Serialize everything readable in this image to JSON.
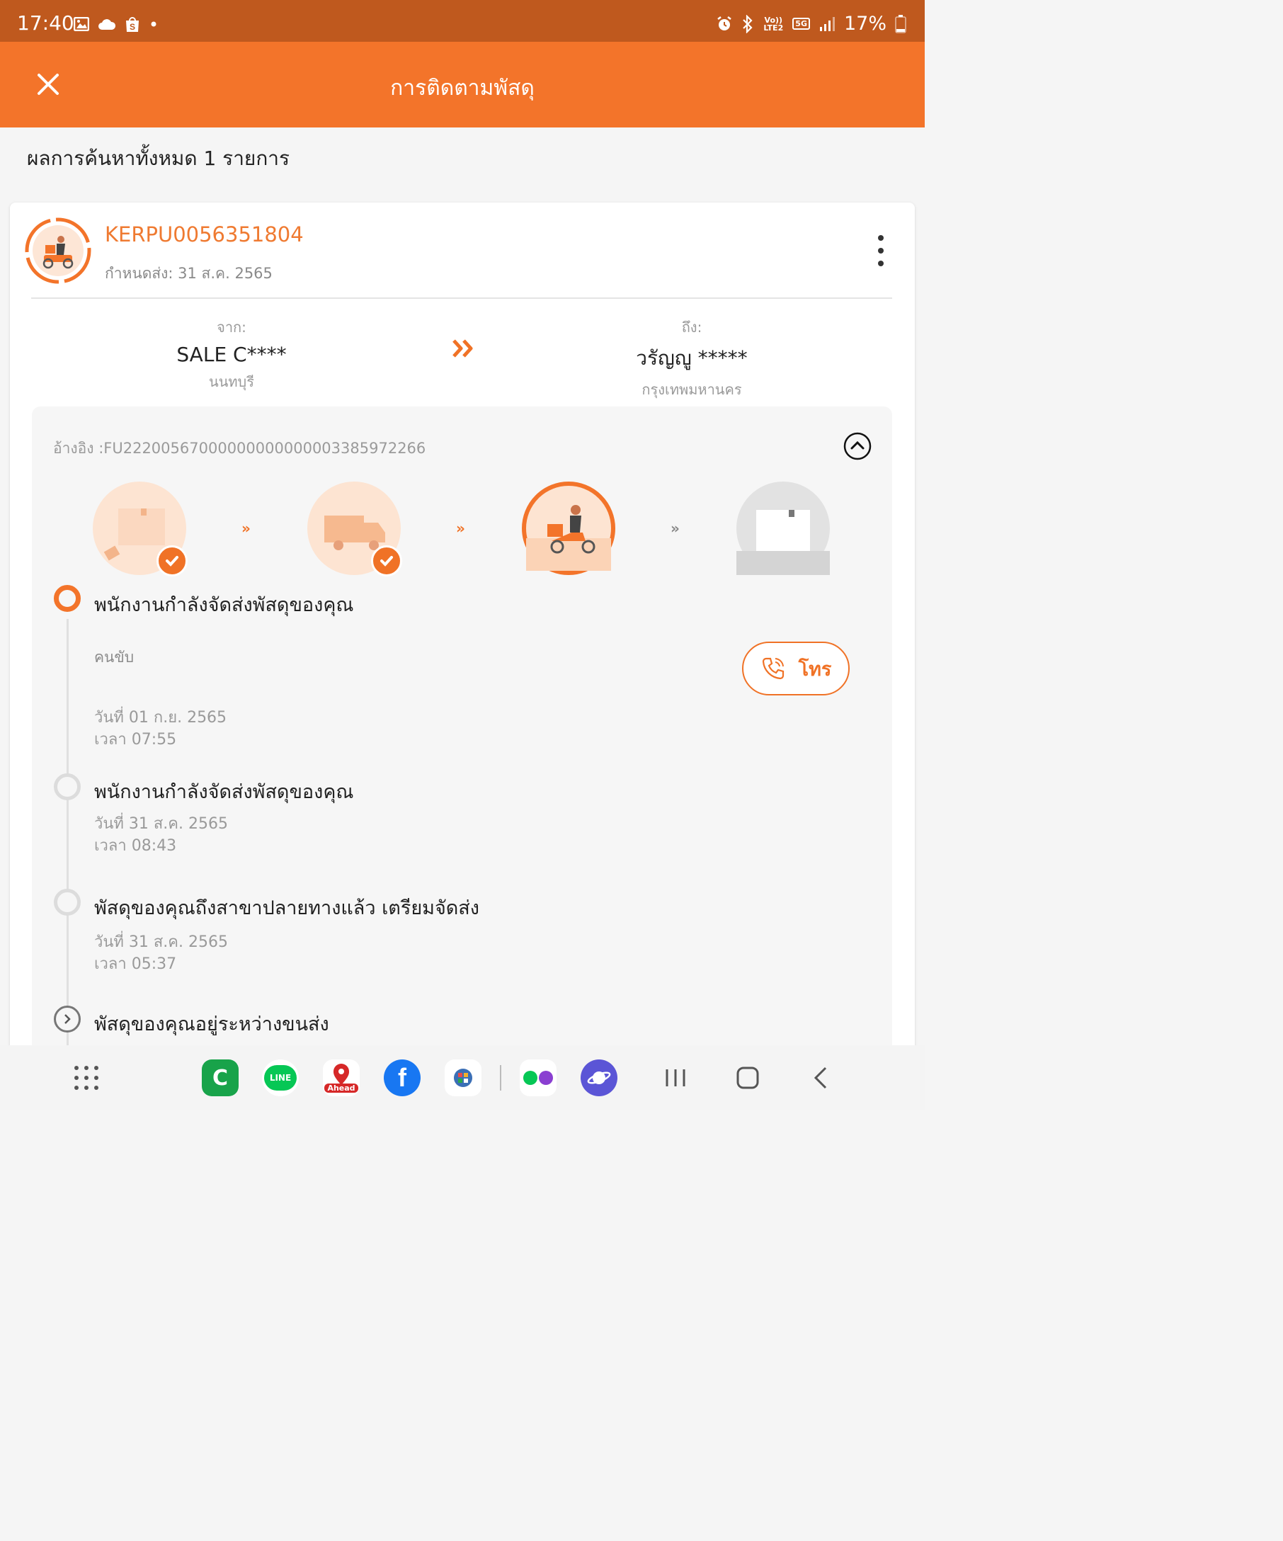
{
  "status_bar": {
    "time": "17:40",
    "battery": "17%",
    "lte_label": "Vo)) LTE2",
    "net_label": "5G",
    "icons": [
      "gallery-icon",
      "cloud-icon",
      "shopee-icon",
      "dot-icon",
      "alarm-icon",
      "bluetooth-icon",
      "signal-icon",
      "battery-icon"
    ]
  },
  "header": {
    "title": "การติดตามพัสดุ",
    "close_icon": "close-icon"
  },
  "summary": "ผลการค้นหาทั้งหมด 1 รายการ",
  "shipment": {
    "tracking_no": "KERPU0056351804",
    "due": "กำหนดส่ง: 31 ส.ค. 2565",
    "from": {
      "label": "จาก:",
      "name": "SALE C****",
      "city": "นนทบุรี"
    },
    "to": {
      "label": "ถึง:",
      "name": "วรัญญู *****",
      "city": "กรุงเทพมหานคร"
    },
    "reference": "อ้างอิง :FU22200567000000000000003385972266",
    "steps": [
      {
        "name": "received",
        "state": "done"
      },
      {
        "name": "in-transit",
        "state": "done"
      },
      {
        "name": "out-for-delivery",
        "state": "current"
      },
      {
        "name": "delivered",
        "state": "pending"
      }
    ],
    "step_separator": "»",
    "driver_label": "คนขับ",
    "call_label": "โทร",
    "timeline": [
      {
        "title": "พนักงานกำลังจัดส่งพัสดุของคุณ",
        "date": "วันที่ 01 ก.ย. 2565",
        "time": "เวลา 07:55"
      },
      {
        "title": "พนักงานกำลังจัดส่งพัสดุของคุณ",
        "date": "วันที่ 31 ส.ค. 2565",
        "time": "เวลา 08:43"
      },
      {
        "title": "พัสดุของคุณถึงสาขาปลายทางแล้ว เตรียมจัดส่ง",
        "date": "วันที่ 31 ส.ค. 2565",
        "time": "เวลา 05:37"
      },
      {
        "title": "พัสดุของคุณอยู่ระหว่างขนส่ง"
      }
    ]
  },
  "navbar": {
    "apps": [
      "apps-grid-icon",
      "c-app-icon",
      "line-icon",
      "ahead-icon",
      "facebook-icon",
      "nt-app-icon",
      "line-pair-icon",
      "internet-icon"
    ],
    "ahead_label": "Ahead",
    "line_label": "LINE",
    "controls": [
      "recents-button",
      "home-button",
      "back-button"
    ]
  },
  "colors": {
    "accent": "#f3742a",
    "status_bar": "#bf591e",
    "muted": "#9a9a9a"
  }
}
